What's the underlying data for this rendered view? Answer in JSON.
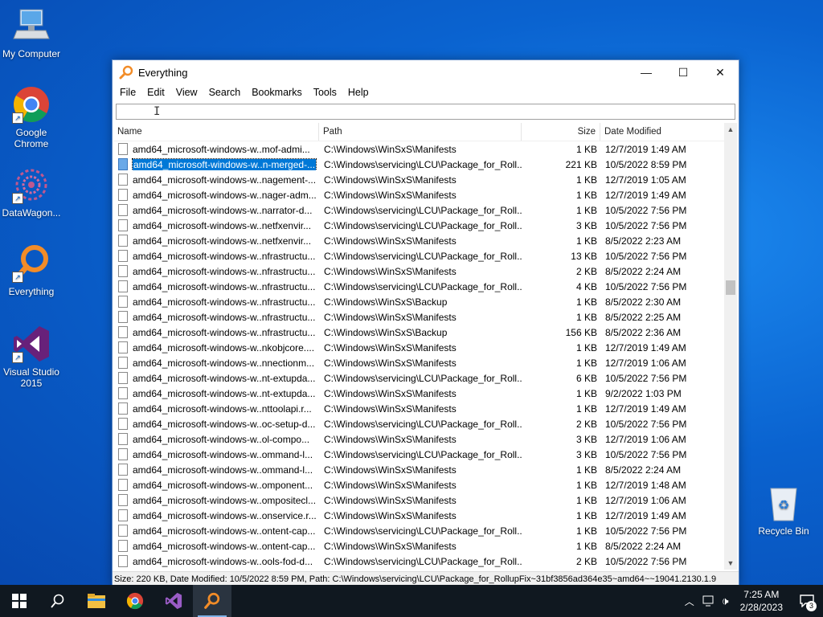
{
  "desktop": {
    "icons": [
      {
        "label": "My Computer",
        "icon": "computer-icon"
      },
      {
        "label": "Google Chrome",
        "icon": "chrome-icon"
      },
      {
        "label": "DataWagon...",
        "icon": "datawagon-icon"
      },
      {
        "label": "Everything",
        "icon": "everything-icon"
      },
      {
        "label": "Visual Studio 2015",
        "icon": "visual-studio-icon"
      },
      {
        "label": "Recycle Bin",
        "icon": "recycle-bin-icon"
      }
    ]
  },
  "window": {
    "title": "Everything",
    "menu": [
      "File",
      "Edit",
      "View",
      "Search",
      "Bookmarks",
      "Tools",
      "Help"
    ],
    "search_value": "",
    "columns": {
      "name": "Name",
      "path": "Path",
      "size": "Size",
      "date": "Date Modified"
    },
    "rows": [
      {
        "name": "amd64_microsoft-windows-w..mof-admi...",
        "path": "C:\\Windows\\WinSxS\\Manifests",
        "size": "1 KB",
        "date": "12/7/2019 1:49 AM"
      },
      {
        "name": "amd64_microsoft-windows-w..n-merged-...",
        "path": "C:\\Windows\\servicing\\LCU\\Package_for_Roll...",
        "size": "221 KB",
        "date": "10/5/2022 8:59 PM",
        "selected": true
      },
      {
        "name": "amd64_microsoft-windows-w..nagement-...",
        "path": "C:\\Windows\\WinSxS\\Manifests",
        "size": "1 KB",
        "date": "12/7/2019 1:05 AM"
      },
      {
        "name": "amd64_microsoft-windows-w..nager-adm...",
        "path": "C:\\Windows\\WinSxS\\Manifests",
        "size": "1 KB",
        "date": "12/7/2019 1:49 AM"
      },
      {
        "name": "amd64_microsoft-windows-w..narrator-d...",
        "path": "C:\\Windows\\servicing\\LCU\\Package_for_Roll...",
        "size": "1 KB",
        "date": "10/5/2022 7:56 PM"
      },
      {
        "name": "amd64_microsoft-windows-w..netfxenvir...",
        "path": "C:\\Windows\\servicing\\LCU\\Package_for_Roll...",
        "size": "3 KB",
        "date": "10/5/2022 7:56 PM"
      },
      {
        "name": "amd64_microsoft-windows-w..netfxenvir...",
        "path": "C:\\Windows\\WinSxS\\Manifests",
        "size": "1 KB",
        "date": "8/5/2022 2:23 AM"
      },
      {
        "name": "amd64_microsoft-windows-w..nfrastructu...",
        "path": "C:\\Windows\\servicing\\LCU\\Package_for_Roll...",
        "size": "13 KB",
        "date": "10/5/2022 7:56 PM"
      },
      {
        "name": "amd64_microsoft-windows-w..nfrastructu...",
        "path": "C:\\Windows\\WinSxS\\Manifests",
        "size": "2 KB",
        "date": "8/5/2022 2:24 AM"
      },
      {
        "name": "amd64_microsoft-windows-w..nfrastructu...",
        "path": "C:\\Windows\\servicing\\LCU\\Package_for_Roll...",
        "size": "4 KB",
        "date": "10/5/2022 7:56 PM"
      },
      {
        "name": "amd64_microsoft-windows-w..nfrastructu...",
        "path": "C:\\Windows\\WinSxS\\Backup",
        "size": "1 KB",
        "date": "8/5/2022 2:30 AM"
      },
      {
        "name": "amd64_microsoft-windows-w..nfrastructu...",
        "path": "C:\\Windows\\WinSxS\\Manifests",
        "size": "1 KB",
        "date": "8/5/2022 2:25 AM"
      },
      {
        "name": "amd64_microsoft-windows-w..nfrastructu...",
        "path": "C:\\Windows\\WinSxS\\Backup",
        "size": "156 KB",
        "date": "8/5/2022 2:36 AM"
      },
      {
        "name": "amd64_microsoft-windows-w..nkobjcore....",
        "path": "C:\\Windows\\WinSxS\\Manifests",
        "size": "1 KB",
        "date": "12/7/2019 1:49 AM"
      },
      {
        "name": "amd64_microsoft-windows-w..nnectionm...",
        "path": "C:\\Windows\\WinSxS\\Manifests",
        "size": "1 KB",
        "date": "12/7/2019 1:06 AM"
      },
      {
        "name": "amd64_microsoft-windows-w..nt-extupda...",
        "path": "C:\\Windows\\servicing\\LCU\\Package_for_Roll...",
        "size": "6 KB",
        "date": "10/5/2022 7:56 PM"
      },
      {
        "name": "amd64_microsoft-windows-w..nt-extupda...",
        "path": "C:\\Windows\\WinSxS\\Manifests",
        "size": "1 KB",
        "date": "9/2/2022 1:03 PM"
      },
      {
        "name": "amd64_microsoft-windows-w..nttoolapi.r...",
        "path": "C:\\Windows\\WinSxS\\Manifests",
        "size": "1 KB",
        "date": "12/7/2019 1:49 AM"
      },
      {
        "name": "amd64_microsoft-windows-w..oc-setup-d...",
        "path": "C:\\Windows\\servicing\\LCU\\Package_for_Roll...",
        "size": "2 KB",
        "date": "10/5/2022 7:56 PM"
      },
      {
        "name": "amd64_microsoft-windows-w..ol-compo...",
        "path": "C:\\Windows\\WinSxS\\Manifests",
        "size": "3 KB",
        "date": "12/7/2019 1:06 AM"
      },
      {
        "name": "amd64_microsoft-windows-w..ommand-l...",
        "path": "C:\\Windows\\servicing\\LCU\\Package_for_Roll...",
        "size": "3 KB",
        "date": "10/5/2022 7:56 PM"
      },
      {
        "name": "amd64_microsoft-windows-w..ommand-l...",
        "path": "C:\\Windows\\WinSxS\\Manifests",
        "size": "1 KB",
        "date": "8/5/2022 2:24 AM"
      },
      {
        "name": "amd64_microsoft-windows-w..omponent...",
        "path": "C:\\Windows\\WinSxS\\Manifests",
        "size": "1 KB",
        "date": "12/7/2019 1:48 AM"
      },
      {
        "name": "amd64_microsoft-windows-w..ompositecl...",
        "path": "C:\\Windows\\WinSxS\\Manifests",
        "size": "1 KB",
        "date": "12/7/2019 1:06 AM"
      },
      {
        "name": "amd64_microsoft-windows-w..onservice.r...",
        "path": "C:\\Windows\\WinSxS\\Manifests",
        "size": "1 KB",
        "date": "12/7/2019 1:49 AM"
      },
      {
        "name": "amd64_microsoft-windows-w..ontent-cap...",
        "path": "C:\\Windows\\servicing\\LCU\\Package_for_Roll...",
        "size": "1 KB",
        "date": "10/5/2022 7:56 PM"
      },
      {
        "name": "amd64_microsoft-windows-w..ontent-cap...",
        "path": "C:\\Windows\\WinSxS\\Manifests",
        "size": "1 KB",
        "date": "8/5/2022 2:24 AM"
      },
      {
        "name": "amd64_microsoft-windows-w..ools-fod-d...",
        "path": "C:\\Windows\\servicing\\LCU\\Package_for_Roll...",
        "size": "2 KB",
        "date": "10/5/2022 7:56 PM"
      }
    ],
    "status": "Size: 220 KB, Date Modified: 10/5/2022 8:59 PM, Path: C:\\Windows\\servicing\\LCU\\Package_for_RollupFix~31bf3856ad364e35~amd64~~19041.2130.1.9"
  },
  "taskbar": {
    "apps": [
      "start-icon",
      "search-icon",
      "file-explorer-icon",
      "chrome-icon",
      "visual-studio-icon",
      "everything-icon"
    ],
    "time": "7:25 AM",
    "date": "2/28/2023",
    "notification_count": "3"
  }
}
